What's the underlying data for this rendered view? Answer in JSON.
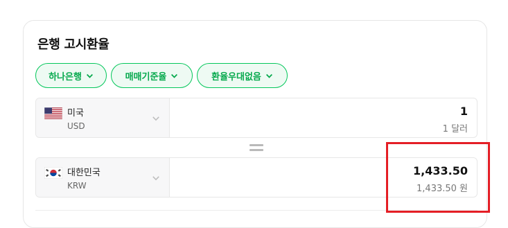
{
  "title": "은행 고시환율",
  "filters": [
    {
      "label": "하나은행"
    },
    {
      "label": "매매기준율"
    },
    {
      "label": "환율우대없음"
    }
  ],
  "rows": [
    {
      "country": "미국",
      "code": "USD",
      "amount": "1",
      "sub": "1 달러",
      "flag": "us-flag"
    },
    {
      "country": "대한민국",
      "code": "KRW",
      "amount": "1,433.50",
      "sub": "1,433.50 원",
      "flag": "kr-flag"
    }
  ],
  "colors": {
    "accent": "#03c75a",
    "highlight": "#e41e25"
  }
}
